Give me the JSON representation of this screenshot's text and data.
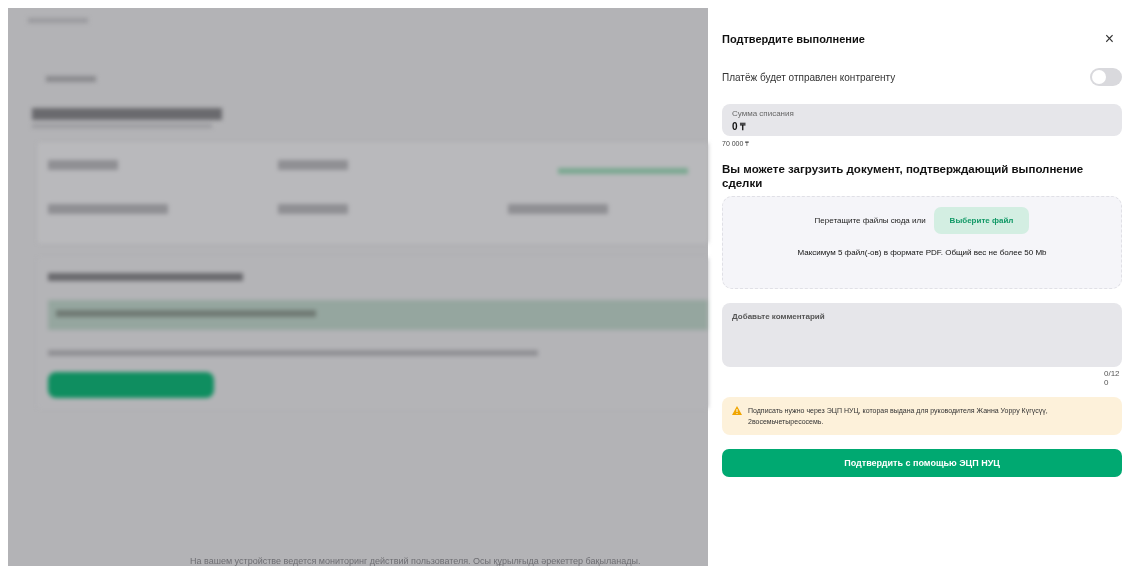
{
  "drawer": {
    "title": "Подтвердите выполнение",
    "close": "×",
    "payment_toggle": {
      "label": "Платёж будет отправлен контрагенту",
      "on": false
    },
    "amount_field": {
      "label": "Сумма списания",
      "value": "0 ₸",
      "hint": "70 000 ₸"
    },
    "upload_heading": "Вы можете загрузить документ, подтверждающий выполнение сделки",
    "dropzone": {
      "text": "Перетащите файлы сюда или",
      "button": "Выберите файл",
      "limits": "Максимум 5 файл(-ов) в формате PDF. Общий вес не более 50 Mb"
    },
    "comment": {
      "placeholder": "Добавьте комментарий",
      "counter": "0/120"
    },
    "warning": "Подписать нужно через ЭЦП НУЦ, которая выдана для руководителя Жанна Уорру Күгүсүү, 2восемьчетыресосемь.",
    "confirm_button": "Подтвердить с помощью ЭЦП НУЦ"
  },
  "footer": "На вашем устройстве ведется мониторинг действий пользователя. Осы құрылғыда әрекеттер бақыланады."
}
